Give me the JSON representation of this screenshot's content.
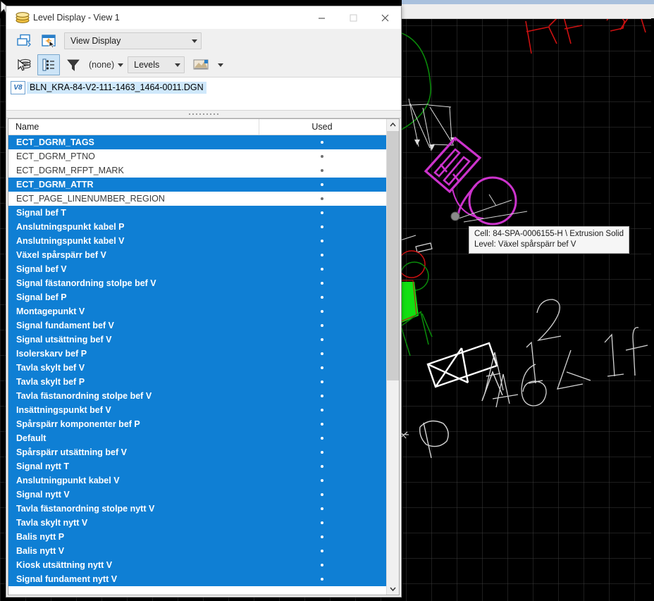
{
  "window": {
    "title": "Level Display - View 1",
    "title_icon": "levels-stack-icon",
    "minimize_glyph": "—",
    "maximize_glyph": "☐",
    "close_glyph": "✕"
  },
  "toolbar": {
    "row1": {
      "btn_levels_manager": "level-manager-icon",
      "btn_view_display": "view-display-icon",
      "view_mode_value": "View Display"
    },
    "row2": {
      "btn_pointer_levels": "pointer-levels-icon",
      "btn_list_view": "list-view-icon",
      "filter_icon": "funnel-icon",
      "filter_value": "(none)",
      "list_type_value": "Levels",
      "symbology_icon": "symbology-icon"
    }
  },
  "file": {
    "icon": "v8-file-icon",
    "icon_label": "V8",
    "name": "BLN_KRA-84-V2-111-1463_1464-0011.DGN"
  },
  "list": {
    "columns": [
      "Name",
      "Used"
    ],
    "rows": [
      {
        "name": "ECT_DGRM_TAGS",
        "used": true,
        "selected": true
      },
      {
        "name": "ECT_DGRM_PTNO",
        "used": true,
        "selected": false
      },
      {
        "name": "ECT_DGRM_RFPT_MARK",
        "used": true,
        "selected": false
      },
      {
        "name": "ECT_DGRM_ATTR",
        "used": true,
        "selected": true
      },
      {
        "name": "ECT_PAGE_LINENUMBER_REGION",
        "used": true,
        "selected": false
      },
      {
        "name": "Signal bef T",
        "used": true,
        "selected": true
      },
      {
        "name": "Anslutningspunkt kabel P",
        "used": true,
        "selected": true
      },
      {
        "name": "Anslutningspunkt kabel V",
        "used": true,
        "selected": true
      },
      {
        "name": "Växel spårspärr bef V",
        "used": true,
        "selected": true
      },
      {
        "name": "Signal bef V",
        "used": true,
        "selected": true
      },
      {
        "name": "Signal fästanordning stolpe bef V",
        "used": true,
        "selected": true
      },
      {
        "name": "Signal bef P",
        "used": true,
        "selected": true
      },
      {
        "name": "Montagepunkt V",
        "used": true,
        "selected": true
      },
      {
        "name": "Signal fundament bef V",
        "used": true,
        "selected": true
      },
      {
        "name": "Signal utsättning bef V",
        "used": true,
        "selected": true
      },
      {
        "name": "Isolerskarv bef P",
        "used": true,
        "selected": true
      },
      {
        "name": "Tavla skylt bef V",
        "used": true,
        "selected": true
      },
      {
        "name": "Tavla skylt bef P",
        "used": true,
        "selected": true
      },
      {
        "name": "Tavla fästanordning stolpe bef V",
        "used": true,
        "selected": true
      },
      {
        "name": "Insättningspunkt bef V",
        "used": true,
        "selected": true
      },
      {
        "name": "Spårspärr komponenter bef P",
        "used": true,
        "selected": true
      },
      {
        "name": "Default",
        "used": true,
        "selected": true
      },
      {
        "name": "Spårspärr utsättning bef V",
        "used": true,
        "selected": true
      },
      {
        "name": "Signal nytt T",
        "used": true,
        "selected": true
      },
      {
        "name": "Anslutningpunkt kabel V",
        "used": true,
        "selected": true
      },
      {
        "name": "Signal nytt V",
        "used": true,
        "selected": true
      },
      {
        "name": "Tavla fästanordning stolpe nytt V",
        "used": true,
        "selected": true
      },
      {
        "name": "Tavla skylt nytt V",
        "used": true,
        "selected": true
      },
      {
        "name": "Balis nytt P",
        "used": true,
        "selected": true
      },
      {
        "name": "Balis nytt V",
        "used": true,
        "selected": true
      },
      {
        "name": "Kiosk utsättning nytt V",
        "used": true,
        "selected": true
      },
      {
        "name": "Signal fundament nytt V",
        "used": true,
        "selected": true
      }
    ]
  },
  "scrollbar": {
    "up_glyph": "▲",
    "down_glyph": "▼"
  },
  "tooltip": {
    "line1": "Cell: 84-SPA-0006155-H \\ Extrusion Solid",
    "line2": "Level: Växel spårspärr bef V"
  },
  "canvas": {
    "background_color": "#000000",
    "grid_color": "#3a3a3a",
    "element_colors": {
      "magenta": "#cc33cc",
      "red": "#cc0000",
      "green_bright": "#00e000",
      "green_dark": "#008000",
      "white": "#e8e8e8",
      "handle_gray": "#808080"
    },
    "annotation_text": "A12 46 41f"
  }
}
